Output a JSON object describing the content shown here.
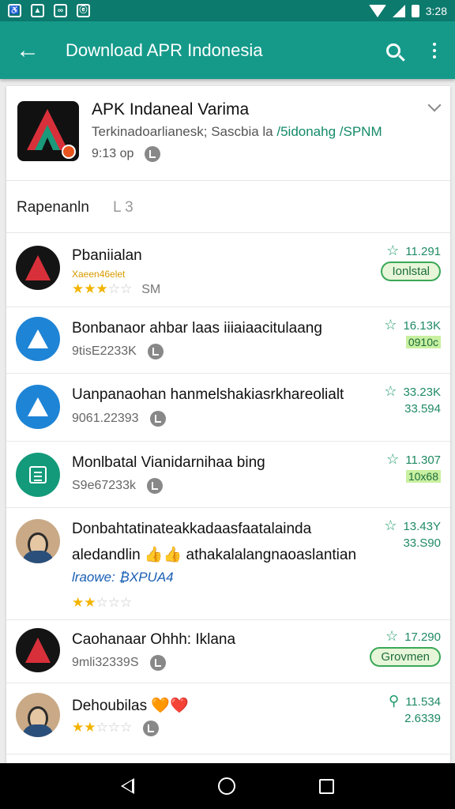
{
  "status": {
    "time": "3:28"
  },
  "appbar": {
    "title": "Download APR Indonesia",
    "back_icon": "arrow-left-icon",
    "search_icon": "search-icon",
    "menu_icon": "more-vert-icon"
  },
  "app": {
    "name": "APK Indaneal Varima",
    "sub_prefix": "Terkinadoarlianesk; Sascbia la ",
    "sub_link": "/5idonahg /SPNM",
    "time": "9:13 op"
  },
  "section": {
    "label": "Rapenanln",
    "count": "L 3"
  },
  "rows": [
    {
      "title": "Pbaniialan",
      "accent": "Xaeen46elet",
      "stars": "★★★",
      "stars_off": "☆☆",
      "meta": "SM",
      "rating": "11.291",
      "action": "Ionlstal"
    },
    {
      "title": "Bonbanaor ahbar laas iiiaiaacitulaang",
      "meta": "9tisE2233K",
      "rating": "16.13K",
      "action": "0910c"
    },
    {
      "title": "Uanpanaohan hanmelshakiasrkhareolialt",
      "meta": "9061.22393",
      "rating": "33.23K",
      "action": "33.594"
    },
    {
      "title": "Monlbatal Vianidarnihaa bing",
      "meta": "S9e67233k",
      "rating": "11.307",
      "action": "10x68"
    },
    {
      "title": "Donbahtatinateakkadaasfaatalainda",
      "line2": "aledandlin 👍👍 athakalalangnaoaslantian",
      "tag": "lraowe: ₿XPUA4",
      "stars": "★★",
      "stars_off": "☆☆☆",
      "rating": "13.43Y",
      "action": "33.S90"
    },
    {
      "title": "Caohanaar Ohhh: Iklana",
      "meta": "9mli32339S",
      "rating": "17.290",
      "action": "Grovmen"
    },
    {
      "title": "Dehoubilas 🧡❤️",
      "stars": "★★",
      "stars_off": "☆☆☆",
      "rating": "11.534",
      "action": "2.6339"
    }
  ]
}
